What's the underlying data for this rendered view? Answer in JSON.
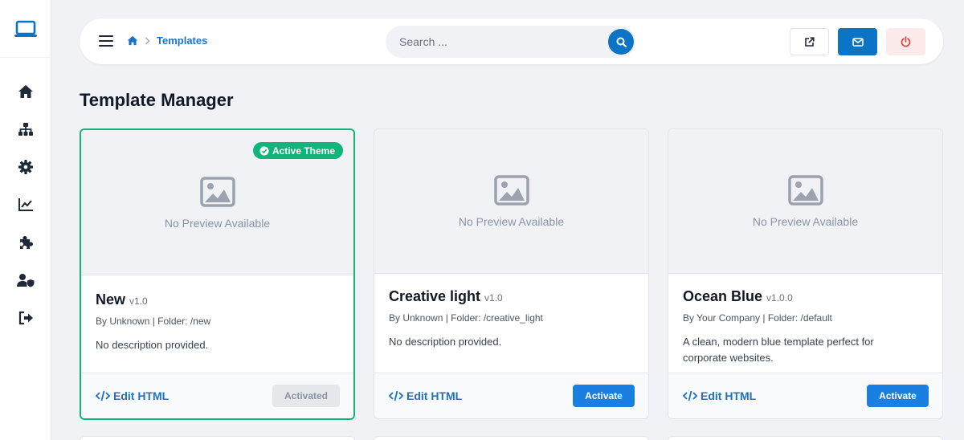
{
  "sidebar": {
    "logo_icon": "laptop-icon",
    "items": [
      {
        "name": "home",
        "icon": "home-icon"
      },
      {
        "name": "sitemap",
        "icon": "sitemap-icon"
      },
      {
        "name": "settings",
        "icon": "gear-icon"
      },
      {
        "name": "analytics",
        "icon": "chart-line-icon"
      },
      {
        "name": "plugins",
        "icon": "puzzle-icon"
      },
      {
        "name": "user-security",
        "icon": "user-shield-icon"
      },
      {
        "name": "logout",
        "icon": "sign-out-icon"
      }
    ]
  },
  "topbar": {
    "breadcrumb": {
      "current": "Templates"
    },
    "search": {
      "placeholder": "Search ..."
    }
  },
  "page": {
    "title": "Template Manager"
  },
  "cards": [
    {
      "name": "New",
      "version": "v1.0",
      "meta": "By Unknown | Folder: /new",
      "description": "No description provided.",
      "preview_text": "No Preview Available",
      "badge": "Active Theme",
      "edit_label": "Edit HTML",
      "action_label": "Activated",
      "active": true
    },
    {
      "name": "Creative light",
      "version": "v1.0",
      "meta": "By Unknown | Folder: /creative_light",
      "description": "No description provided.",
      "preview_text": "No Preview Available",
      "edit_label": "Edit HTML",
      "action_label": "Activate",
      "active": false
    },
    {
      "name": "Ocean Blue",
      "version": "v1.0.0",
      "meta": "By Your Company | Folder: /default",
      "description": "A clean, modern blue template perfect for corporate websites.",
      "preview_text": "No Preview Available",
      "edit_label": "Edit HTML",
      "action_label": "Activate",
      "active": false
    }
  ],
  "colors": {
    "primary": "#0b74c4",
    "link": "#1a73c7",
    "success": "#10b57a",
    "activate_button": "#1a7fe0",
    "danger": "#e23b3b",
    "background": "#f0f2f6"
  }
}
